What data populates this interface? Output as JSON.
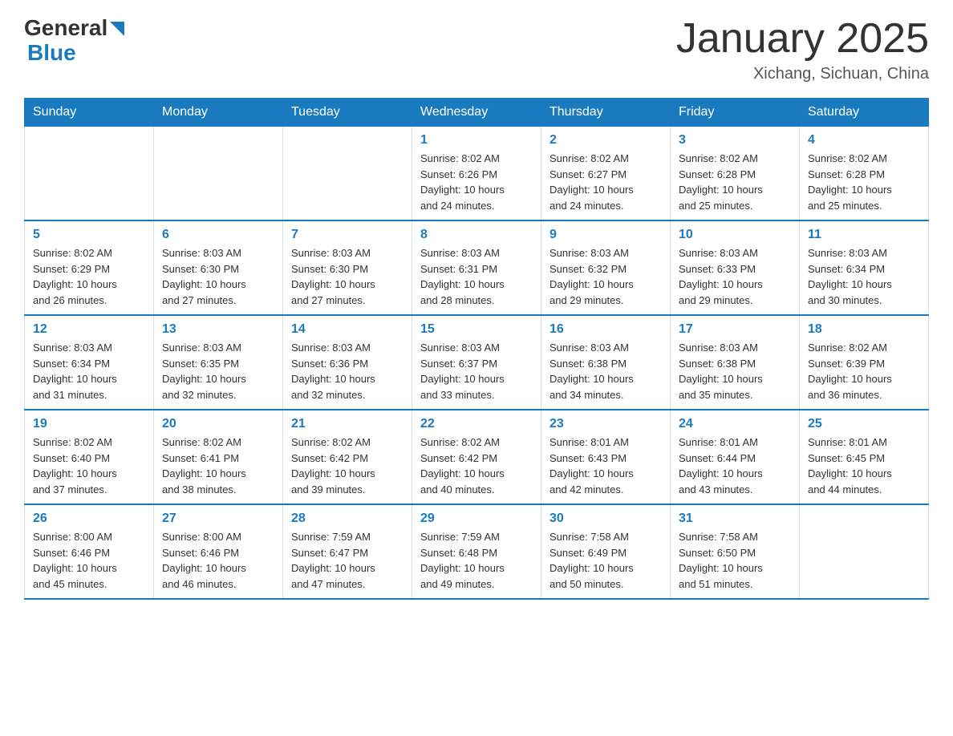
{
  "logo": {
    "general": "General",
    "blue": "Blue"
  },
  "title": "January 2025",
  "subtitle": "Xichang, Sichuan, China",
  "headers": [
    "Sunday",
    "Monday",
    "Tuesday",
    "Wednesday",
    "Thursday",
    "Friday",
    "Saturday"
  ],
  "weeks": [
    [
      {
        "day": "",
        "info": ""
      },
      {
        "day": "",
        "info": ""
      },
      {
        "day": "",
        "info": ""
      },
      {
        "day": "1",
        "info": "Sunrise: 8:02 AM\nSunset: 6:26 PM\nDaylight: 10 hours\nand 24 minutes."
      },
      {
        "day": "2",
        "info": "Sunrise: 8:02 AM\nSunset: 6:27 PM\nDaylight: 10 hours\nand 24 minutes."
      },
      {
        "day": "3",
        "info": "Sunrise: 8:02 AM\nSunset: 6:28 PM\nDaylight: 10 hours\nand 25 minutes."
      },
      {
        "day": "4",
        "info": "Sunrise: 8:02 AM\nSunset: 6:28 PM\nDaylight: 10 hours\nand 25 minutes."
      }
    ],
    [
      {
        "day": "5",
        "info": "Sunrise: 8:02 AM\nSunset: 6:29 PM\nDaylight: 10 hours\nand 26 minutes."
      },
      {
        "day": "6",
        "info": "Sunrise: 8:03 AM\nSunset: 6:30 PM\nDaylight: 10 hours\nand 27 minutes."
      },
      {
        "day": "7",
        "info": "Sunrise: 8:03 AM\nSunset: 6:30 PM\nDaylight: 10 hours\nand 27 minutes."
      },
      {
        "day": "8",
        "info": "Sunrise: 8:03 AM\nSunset: 6:31 PM\nDaylight: 10 hours\nand 28 minutes."
      },
      {
        "day": "9",
        "info": "Sunrise: 8:03 AM\nSunset: 6:32 PM\nDaylight: 10 hours\nand 29 minutes."
      },
      {
        "day": "10",
        "info": "Sunrise: 8:03 AM\nSunset: 6:33 PM\nDaylight: 10 hours\nand 29 minutes."
      },
      {
        "day": "11",
        "info": "Sunrise: 8:03 AM\nSunset: 6:34 PM\nDaylight: 10 hours\nand 30 minutes."
      }
    ],
    [
      {
        "day": "12",
        "info": "Sunrise: 8:03 AM\nSunset: 6:34 PM\nDaylight: 10 hours\nand 31 minutes."
      },
      {
        "day": "13",
        "info": "Sunrise: 8:03 AM\nSunset: 6:35 PM\nDaylight: 10 hours\nand 32 minutes."
      },
      {
        "day": "14",
        "info": "Sunrise: 8:03 AM\nSunset: 6:36 PM\nDaylight: 10 hours\nand 32 minutes."
      },
      {
        "day": "15",
        "info": "Sunrise: 8:03 AM\nSunset: 6:37 PM\nDaylight: 10 hours\nand 33 minutes."
      },
      {
        "day": "16",
        "info": "Sunrise: 8:03 AM\nSunset: 6:38 PM\nDaylight: 10 hours\nand 34 minutes."
      },
      {
        "day": "17",
        "info": "Sunrise: 8:03 AM\nSunset: 6:38 PM\nDaylight: 10 hours\nand 35 minutes."
      },
      {
        "day": "18",
        "info": "Sunrise: 8:02 AM\nSunset: 6:39 PM\nDaylight: 10 hours\nand 36 minutes."
      }
    ],
    [
      {
        "day": "19",
        "info": "Sunrise: 8:02 AM\nSunset: 6:40 PM\nDaylight: 10 hours\nand 37 minutes."
      },
      {
        "day": "20",
        "info": "Sunrise: 8:02 AM\nSunset: 6:41 PM\nDaylight: 10 hours\nand 38 minutes."
      },
      {
        "day": "21",
        "info": "Sunrise: 8:02 AM\nSunset: 6:42 PM\nDaylight: 10 hours\nand 39 minutes."
      },
      {
        "day": "22",
        "info": "Sunrise: 8:02 AM\nSunset: 6:42 PM\nDaylight: 10 hours\nand 40 minutes."
      },
      {
        "day": "23",
        "info": "Sunrise: 8:01 AM\nSunset: 6:43 PM\nDaylight: 10 hours\nand 42 minutes."
      },
      {
        "day": "24",
        "info": "Sunrise: 8:01 AM\nSunset: 6:44 PM\nDaylight: 10 hours\nand 43 minutes."
      },
      {
        "day": "25",
        "info": "Sunrise: 8:01 AM\nSunset: 6:45 PM\nDaylight: 10 hours\nand 44 minutes."
      }
    ],
    [
      {
        "day": "26",
        "info": "Sunrise: 8:00 AM\nSunset: 6:46 PM\nDaylight: 10 hours\nand 45 minutes."
      },
      {
        "day": "27",
        "info": "Sunrise: 8:00 AM\nSunset: 6:46 PM\nDaylight: 10 hours\nand 46 minutes."
      },
      {
        "day": "28",
        "info": "Sunrise: 7:59 AM\nSunset: 6:47 PM\nDaylight: 10 hours\nand 47 minutes."
      },
      {
        "day": "29",
        "info": "Sunrise: 7:59 AM\nSunset: 6:48 PM\nDaylight: 10 hours\nand 49 minutes."
      },
      {
        "day": "30",
        "info": "Sunrise: 7:58 AM\nSunset: 6:49 PM\nDaylight: 10 hours\nand 50 minutes."
      },
      {
        "day": "31",
        "info": "Sunrise: 7:58 AM\nSunset: 6:50 PM\nDaylight: 10 hours\nand 51 minutes."
      },
      {
        "day": "",
        "info": ""
      }
    ]
  ]
}
